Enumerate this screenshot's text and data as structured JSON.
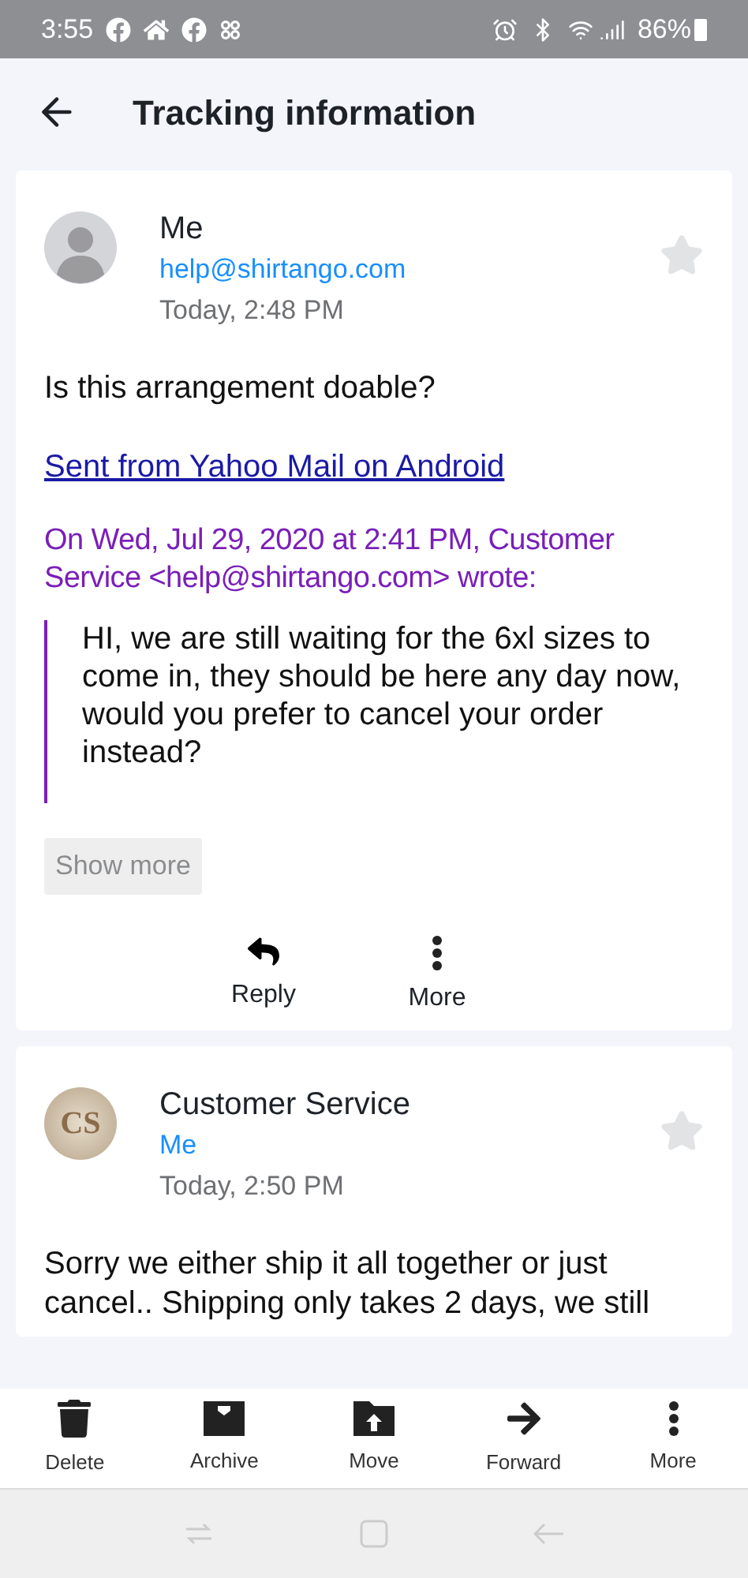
{
  "status_bar": {
    "time": "3:55",
    "battery": "86%"
  },
  "header": {
    "title": "Tracking information"
  },
  "messages": [
    {
      "avatar": {
        "kind": "silhouette"
      },
      "sender": "Me",
      "recipient": "help@shirtango.com",
      "time": "Today, 2:48 PM",
      "starred": false,
      "body": "Is this arrangement doable?",
      "signature": "Sent from Yahoo Mail on Android",
      "quote_header": "On Wed, Jul 29, 2020 at 2:41 PM, Customer Service <help@shirtango.com> wrote:",
      "quote": "HI, we are still waiting for the 6xl sizes to come in, they should be here any day now, would you prefer to cancel your order instead?",
      "show_more": "Show more",
      "actions": [
        {
          "kind": "reply",
          "label": "Reply"
        },
        {
          "kind": "more",
          "label": "More"
        }
      ]
    },
    {
      "avatar": {
        "kind": "initials",
        "text": "CS"
      },
      "sender": "Customer Service",
      "recipient": "Me",
      "time": "Today, 2:50 PM",
      "starred": false,
      "body": "Sorry we either ship it all together or just cancel.. Shipping only takes 2 days, we still"
    }
  ],
  "toolbar": [
    {
      "kind": "delete",
      "label": "Delete"
    },
    {
      "kind": "archive",
      "label": "Archive"
    },
    {
      "kind": "move",
      "label": "Move"
    },
    {
      "kind": "forward",
      "label": "Forward"
    },
    {
      "kind": "more",
      "label": "More"
    }
  ]
}
